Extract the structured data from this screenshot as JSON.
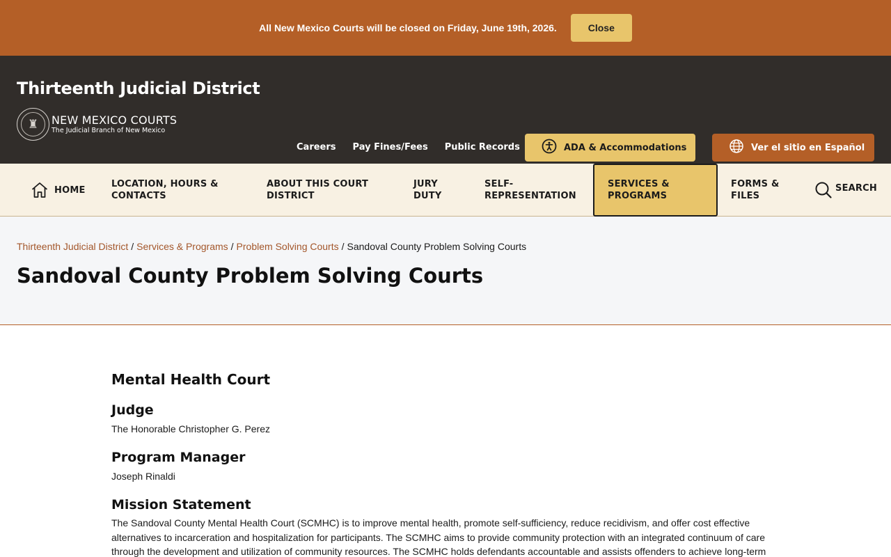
{
  "alert": {
    "message": "All New Mexico Courts will be closed on Friday, June 19th, 2026.",
    "close_label": "Close"
  },
  "header": {
    "site_title": "Thirteenth Judicial District",
    "logo_name": "NEW MEXICO COURTS",
    "logo_tagline": "The Judicial Branch of New Mexico",
    "links": [
      "Careers",
      "Pay Fines/Fees",
      "Public Records"
    ],
    "ada_label": "ADA & Accommodations",
    "spanish_label": "Ver el sitio en Español"
  },
  "nav": {
    "home": "HOME",
    "location": "LOCATION, HOURS & CONTACTS",
    "about": "ABOUT THIS COURT DISTRICT",
    "jury": "JURY DUTY",
    "self_rep": "SELF-REPRESENTATION",
    "services": "SERVICES & PROGRAMS",
    "forms": "FORMS & FILES",
    "search": "SEARCH",
    "active": "SERVICES & PROGRAMS"
  },
  "breadcrumb": {
    "items": [
      "Thirteenth Judicial District",
      "Services & Programs",
      "Problem Solving Courts"
    ],
    "current": "Sandoval County Problem Solving Courts",
    "separator": "/"
  },
  "page_title": "Sandoval County Problem Solving Courts",
  "content": {
    "section_title": "Mental Health Court",
    "judge_heading": "Judge",
    "judge_name": "The Honorable Christopher G. Perez",
    "manager_heading": "Program Manager",
    "manager_name": "Joseph Rinaldi",
    "mission_heading": "Mission Statement",
    "mission_text": "The Sandoval County Mental Health Court (SCMHC) is to improve mental health, promote self-sufficiency, reduce recidivism, and offer cost effective alternatives to incarceration and hospitalization for participants.  The SCMHC aims to provide community protection with an integrated continuum of care through the development and utilization of community resources. The SCMHC holds defendants accountable and assists offenders to achieve long-term"
  },
  "colors": {
    "brand_orange": "#b45f27",
    "gold": "#e8c56b",
    "header_dark": "#312d2a",
    "nav_bg": "#f8f1e3"
  }
}
